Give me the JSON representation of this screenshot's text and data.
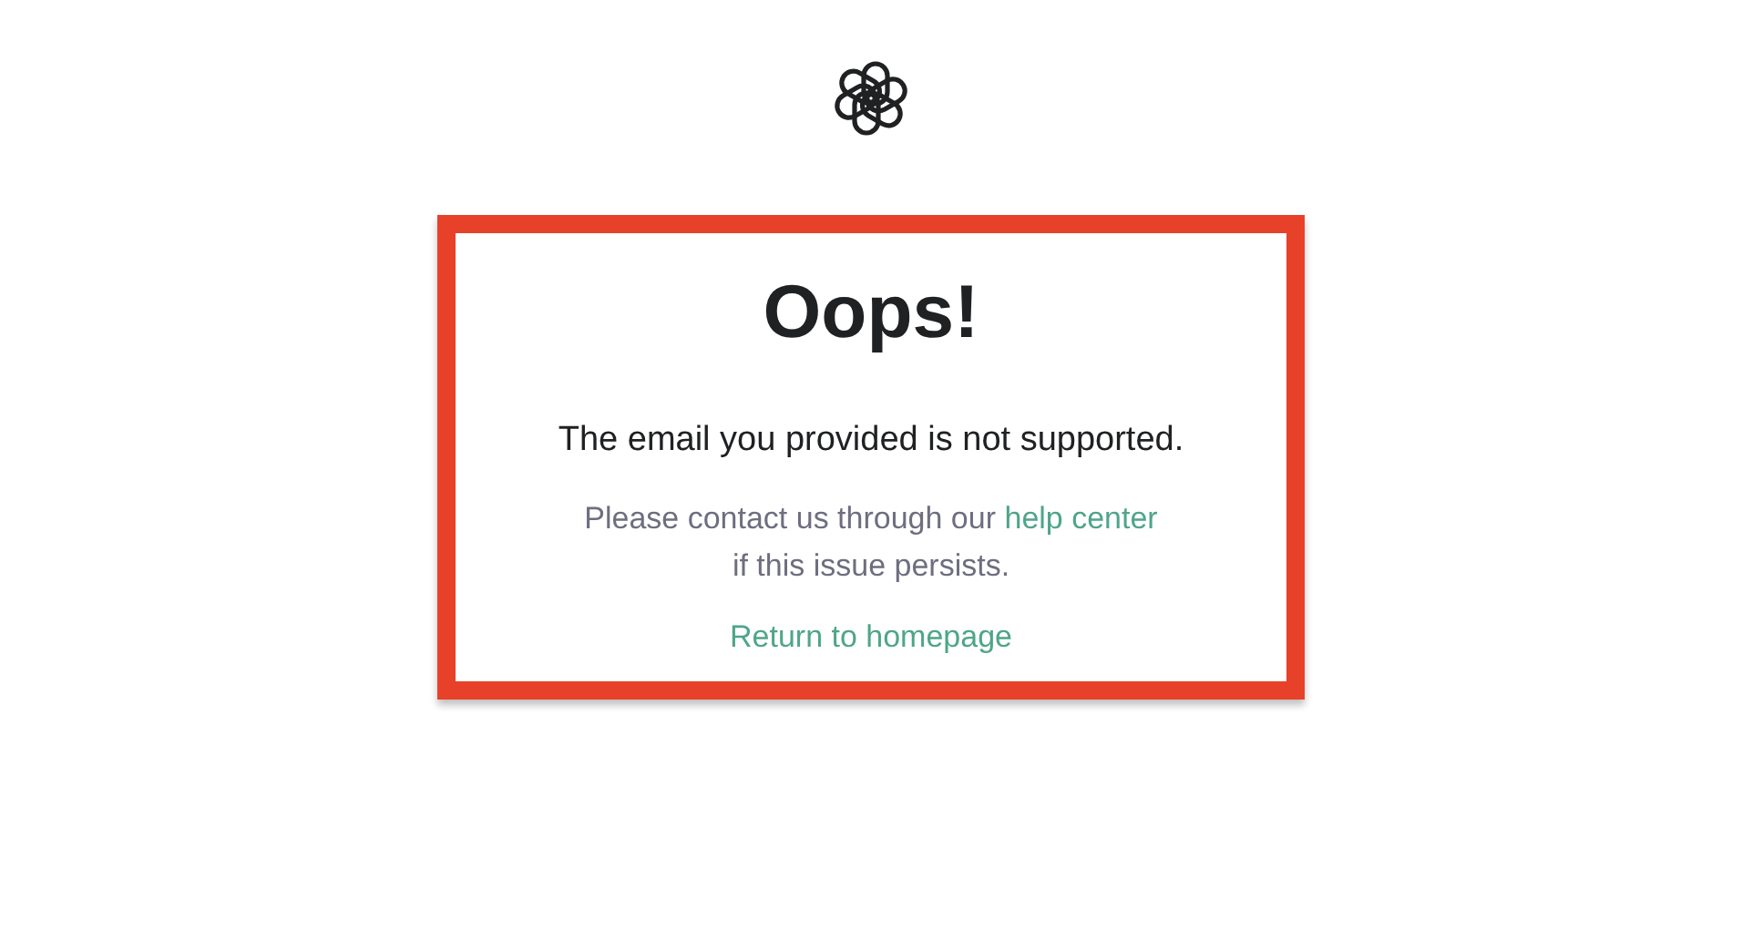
{
  "card": {
    "title": "Oops!",
    "message": "The email you provided is not supported.",
    "help_text": {
      "before": "Please contact us through our",
      "link": "help center",
      "after": "if this issue persists."
    },
    "return_link": "Return to homepage"
  }
}
